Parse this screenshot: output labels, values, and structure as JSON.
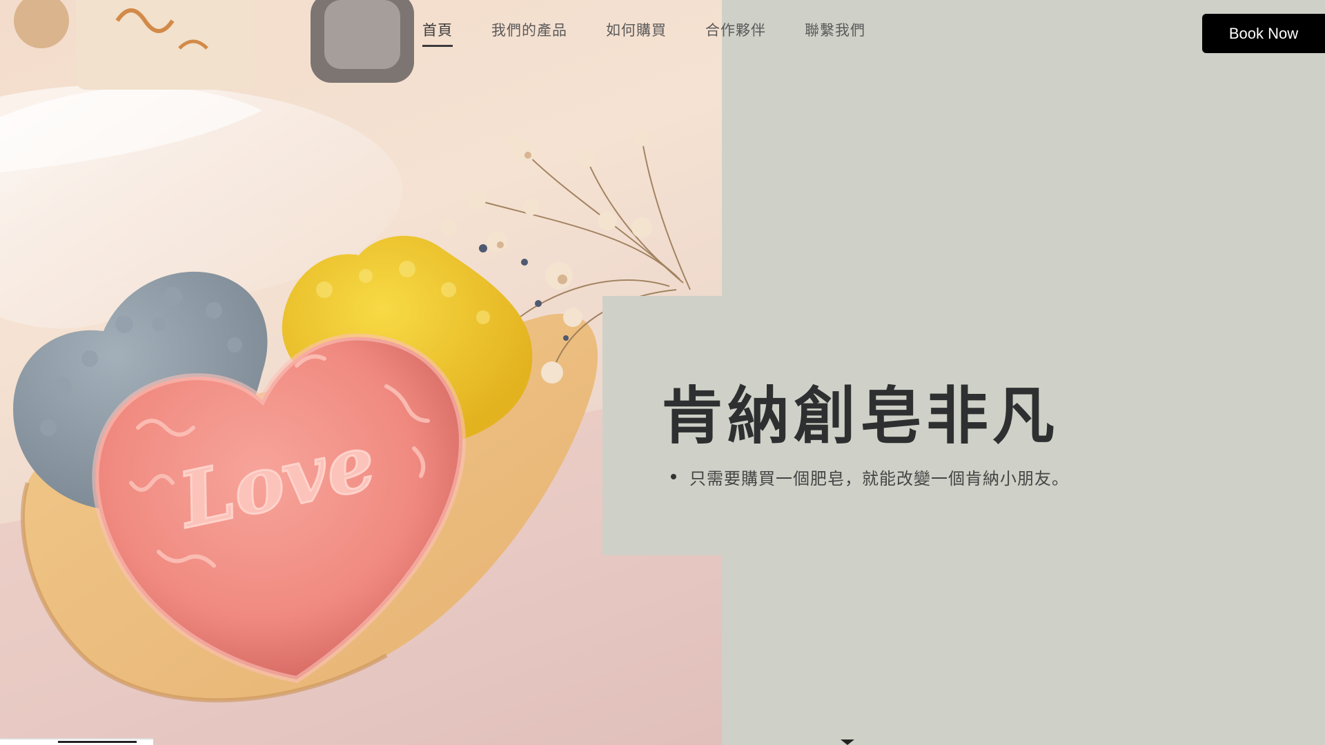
{
  "nav": {
    "items": [
      {
        "label": "首頁",
        "active": true
      },
      {
        "label": "我們的產品",
        "active": false
      },
      {
        "label": "如何購買",
        "active": false
      },
      {
        "label": "合作夥伴",
        "active": false
      },
      {
        "label": "聯繫我們",
        "active": false
      }
    ],
    "book_label": "Book Now"
  },
  "hero": {
    "title": "肯納創皂非凡",
    "bullets": [
      "只需要購買一個肥皂，就能改變一個肯納小朋友。"
    ],
    "image_embossed_text": "Love"
  },
  "colors": {
    "background": "#cfd1c8",
    "button": "#000000",
    "title": "#2d2f30"
  }
}
